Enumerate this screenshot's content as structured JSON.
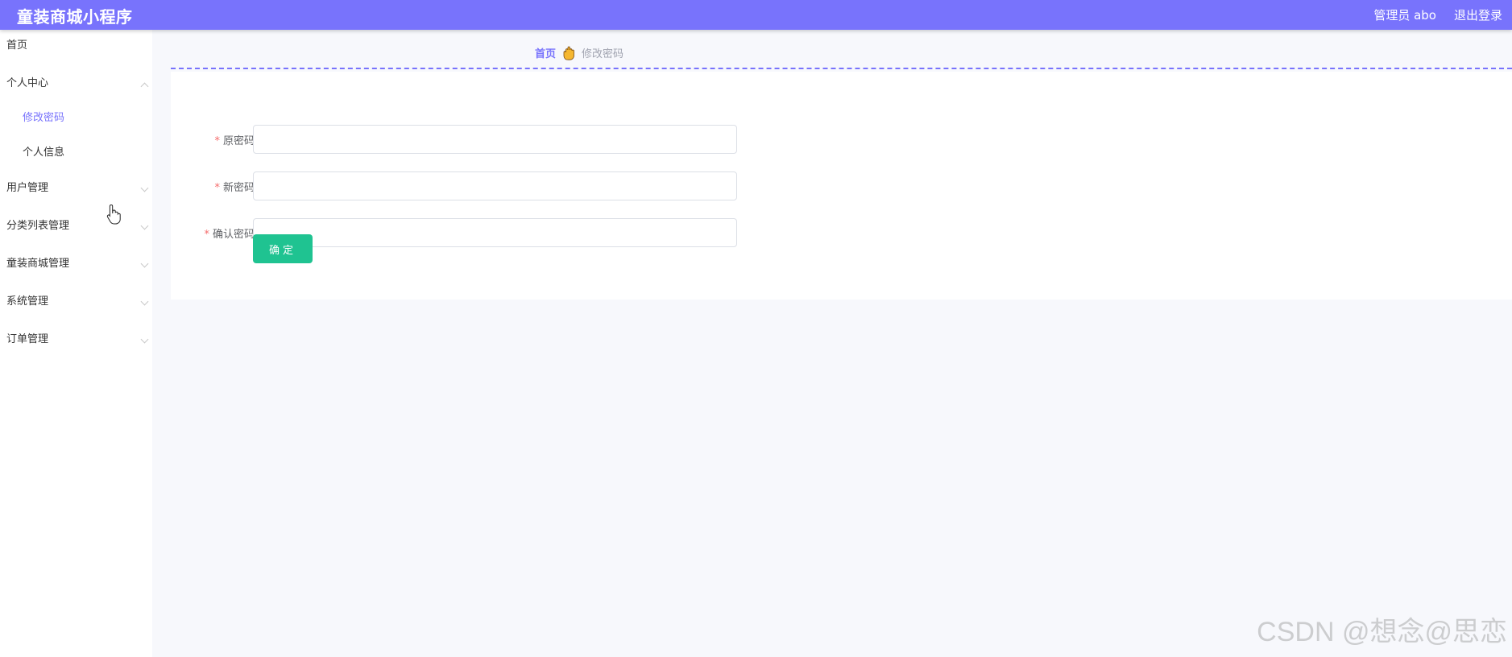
{
  "header": {
    "app_title": "童装商城小程序",
    "user_label": "管理员 abo",
    "logout_label": "退出登录"
  },
  "sidebar": {
    "items": [
      {
        "label": "首页",
        "expandable": false
      },
      {
        "label": "个人中心",
        "expandable": true,
        "expanded": true
      },
      {
        "label": "修改密码",
        "sub": true,
        "active": true
      },
      {
        "label": "个人信息",
        "sub": true
      },
      {
        "label": "用户管理",
        "expandable": true
      },
      {
        "label": "分类列表管理",
        "expandable": true
      },
      {
        "label": "童装商城管理",
        "expandable": true
      },
      {
        "label": "系统管理",
        "expandable": true
      },
      {
        "label": "订单管理",
        "expandable": true
      }
    ]
  },
  "breadcrumb": {
    "home": "首页",
    "current": "修改密码",
    "separator_icon": "hand-icon"
  },
  "form": {
    "required_mark": "*",
    "fields": [
      {
        "label": "原密码",
        "value": "",
        "placeholder": ""
      },
      {
        "label": "新密码",
        "value": "",
        "placeholder": ""
      },
      {
        "label": "确认密码",
        "value": "",
        "placeholder": ""
      }
    ],
    "submit_label": "确定"
  },
  "watermark": "CSDN @想念@思恋",
  "colors": {
    "primary": "#7873fc",
    "confirm": "#1fc391",
    "required": "#f56c6c"
  }
}
